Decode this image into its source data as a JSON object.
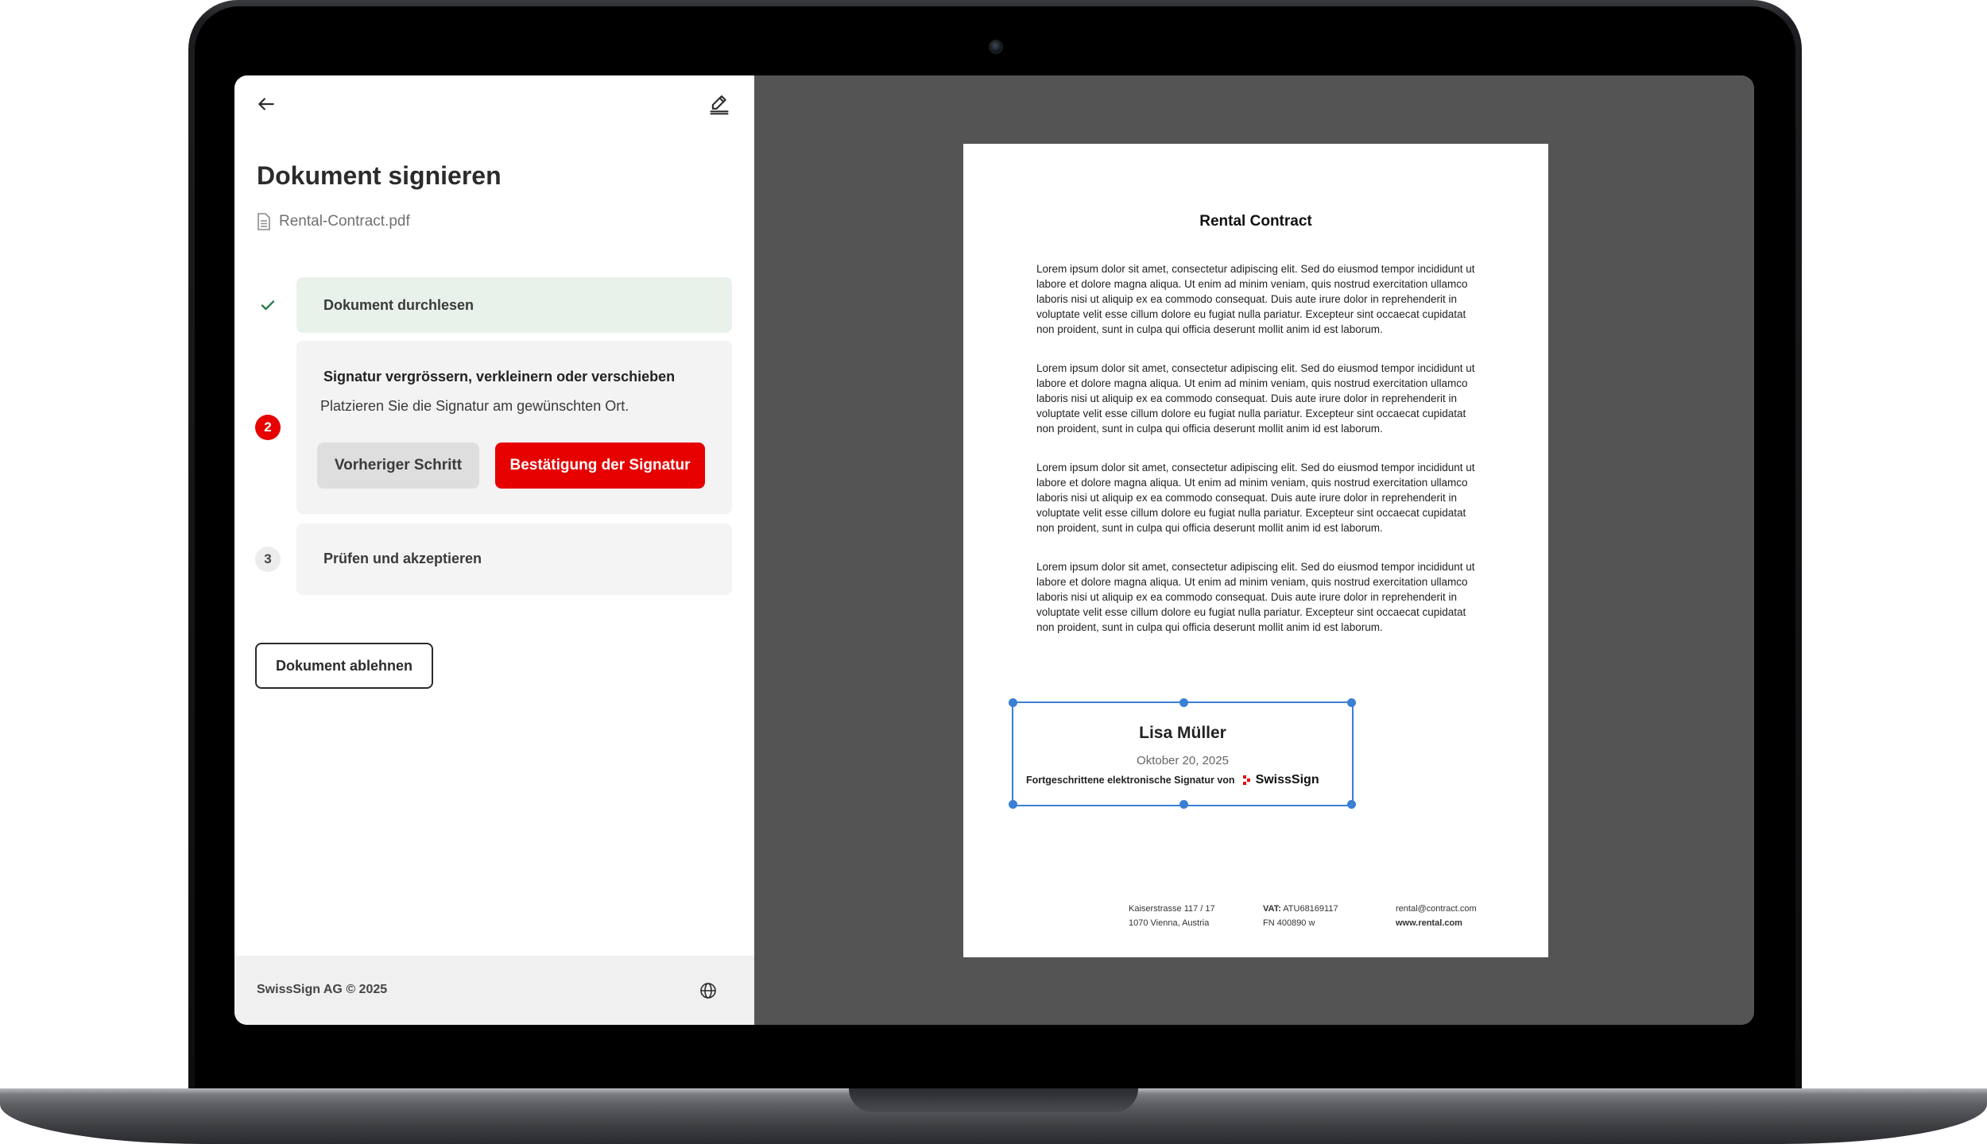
{
  "panel": {
    "title": "Dokument signieren",
    "file_name": "Rental-Contract.pdf",
    "steps": [
      {
        "marker": "✓",
        "label": "Dokument durchlesen",
        "status": "done"
      },
      {
        "marker": "2",
        "label": "Signatur vergrössern, verkleinern oder verschieben",
        "description": "Platzieren Sie die Signatur am gewünschten Ort.",
        "status": "active"
      },
      {
        "marker": "3",
        "label": "Prüfen und akzeptieren",
        "status": "pending"
      }
    ],
    "prev_button": "Vorheriger Schritt",
    "confirm_button": "Bestätigung der Signatur",
    "decline_button": "Dokument ablehnen",
    "footer_text": "SwissSign AG © 2025"
  },
  "document": {
    "title": "Rental Contract",
    "paragraphs": [
      "Lorem ipsum dolor sit amet, consectetur adipiscing elit. Sed do eiusmod tempor incididunt ut labore et dolore magna aliqua. Ut enim ad minim veniam, quis nostrud exercitation ullamco laboris nisi ut aliquip ex ea commodo consequat. Duis aute irure dolor in reprehenderit in voluptate velit esse cillum dolore eu fugiat nulla pariatur. Excepteur sint occaecat cupidatat non proident, sunt in culpa qui officia deserunt mollit anim id est laborum.",
      "Lorem ipsum dolor sit amet, consectetur adipiscing elit. Sed do eiusmod tempor incididunt ut labore et dolore magna aliqua. Ut enim ad minim veniam, quis nostrud exercitation ullamco laboris nisi ut aliquip ex ea commodo consequat. Duis aute irure dolor in reprehenderit in voluptate velit esse cillum dolore eu fugiat nulla pariatur. Excepteur sint occaecat cupidatat non proident, sunt in culpa qui officia deserunt mollit anim id est laborum.",
      "Lorem ipsum dolor sit amet, consectetur adipiscing elit. Sed do eiusmod tempor incididunt ut labore et dolore magna aliqua. Ut enim ad minim veniam, quis nostrud exercitation ullamco laboris nisi ut aliquip ex ea commodo consequat. Duis aute irure dolor in reprehenderit in voluptate velit esse cillum dolore eu fugiat nulla pariatur. Excepteur sint occaecat cupidatat non proident, sunt in culpa qui officia deserunt mollit anim id est laborum.",
      "Lorem ipsum dolor sit amet, consectetur adipiscing elit. Sed do eiusmod tempor incididunt ut labore et dolore magna aliqua. Ut enim ad minim veniam, quis nostrud exercitation ullamco laboris nisi ut aliquip ex ea commodo consequat. Duis aute irure dolor in reprehenderit in voluptate velit esse cillum dolore eu fugiat nulla pariatur. Excepteur sint occaecat cupidatat non proident, sunt in culpa qui officia deserunt mollit anim id est laborum."
    ],
    "signature": {
      "name": "Lisa Müller",
      "date": "Oktober 20, 2025",
      "caption": "Fortgeschrittene elektronische Signatur von",
      "brand": "SwissSign"
    },
    "footer": {
      "address_line1": "Kaiserstrasse 117 / 17",
      "address_line2": "1070 Vienna, Austria",
      "vat_label": "VAT:",
      "vat_value": "ATU68169117",
      "fn": "FN 400890 w",
      "email": "rental@contract.com",
      "website": "www.rental.com"
    }
  },
  "colors": {
    "accent_red": "#e60000",
    "done_bg": "#e9f2ea",
    "done_check": "#2e7d4f",
    "selection_blue": "#3a7fd6",
    "viewer_bg": "#545454"
  },
  "icons": {
    "back": "arrow-left-icon",
    "edit": "signature-pen-icon",
    "file": "file-icon",
    "globe": "globe-icon",
    "check": "check-icon",
    "brand": "swisssign-logo-icon"
  }
}
